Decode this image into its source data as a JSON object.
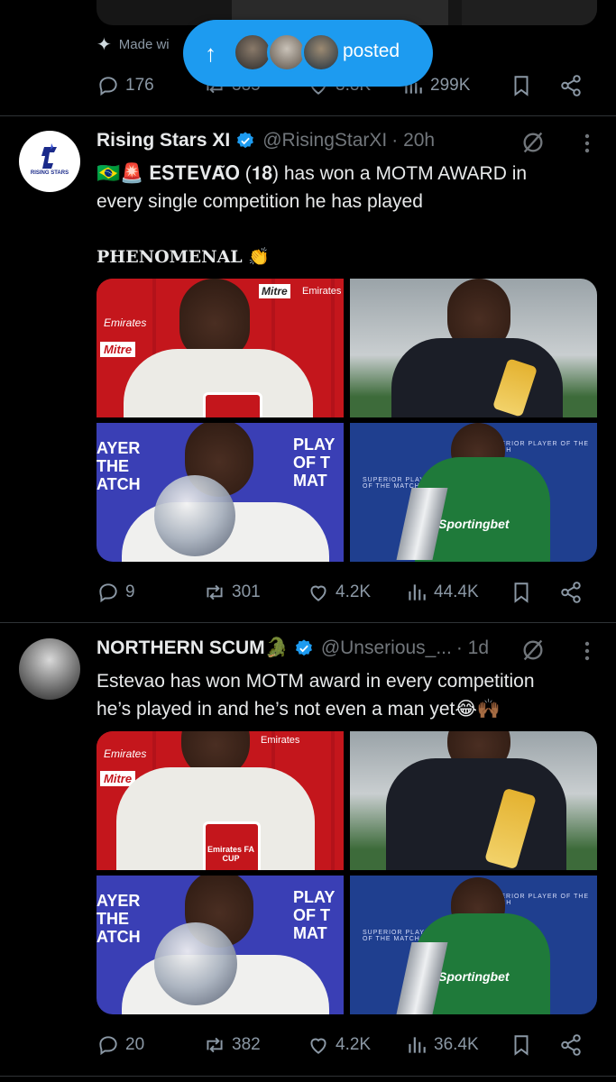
{
  "top": {
    "made_with": "Made wi",
    "stats": {
      "replies": "176",
      "reposts": "385",
      "likes": "3.8K",
      "views": "299K"
    }
  },
  "new_posts_pill": {
    "label": "posted"
  },
  "tweets": [
    {
      "name": "Rising Stars XI",
      "handle": "@RisingStarXI",
      "time": "· 20h",
      "avatar_text": "RISING STARS",
      "text_line1": "🇧🇷🚨 𝐄𝐒𝐓𝐄𝐕𝐀̃𝐎 (𝟏𝟖) has won a MOTM AWARD in",
      "text_line2": "every single competition he has played",
      "text_line3": "𝐏𝐇𝐄𝐍𝐎𝐌𝐄𝐍𝐀𝐋 👏",
      "stats": {
        "replies": "9",
        "reposts": "301",
        "likes": "4.2K",
        "views": "44.4K"
      }
    },
    {
      "name": "NORTHERN SCUM🐊",
      "handle": "@Unserious_...",
      "time": "· 1d",
      "text_line1": "Estevao has won MOTM award in every competition",
      "text_line2": "he’s played in and he’s not even a man yet😂🙌🏾",
      "stats": {
        "replies": "20",
        "reposts": "382",
        "likes": "4.2K",
        "views": "36.4K"
      }
    }
  ],
  "media_text": {
    "brand_mitre": "Mitre",
    "brand_emirates": "Emirates",
    "fa_cup": "Emirates FA CUP",
    "potm_left": "AYER THE ATCH",
    "potm_right": "PLAY OF T MAT",
    "superior": "SUPERIOR PLAYER OF THE MATCH",
    "sponsor": "Sportingbet"
  },
  "colors": {
    "accent": "#1d9bf0",
    "bg": "#000000",
    "muted": "#71767b",
    "divider": "#2f3336"
  }
}
